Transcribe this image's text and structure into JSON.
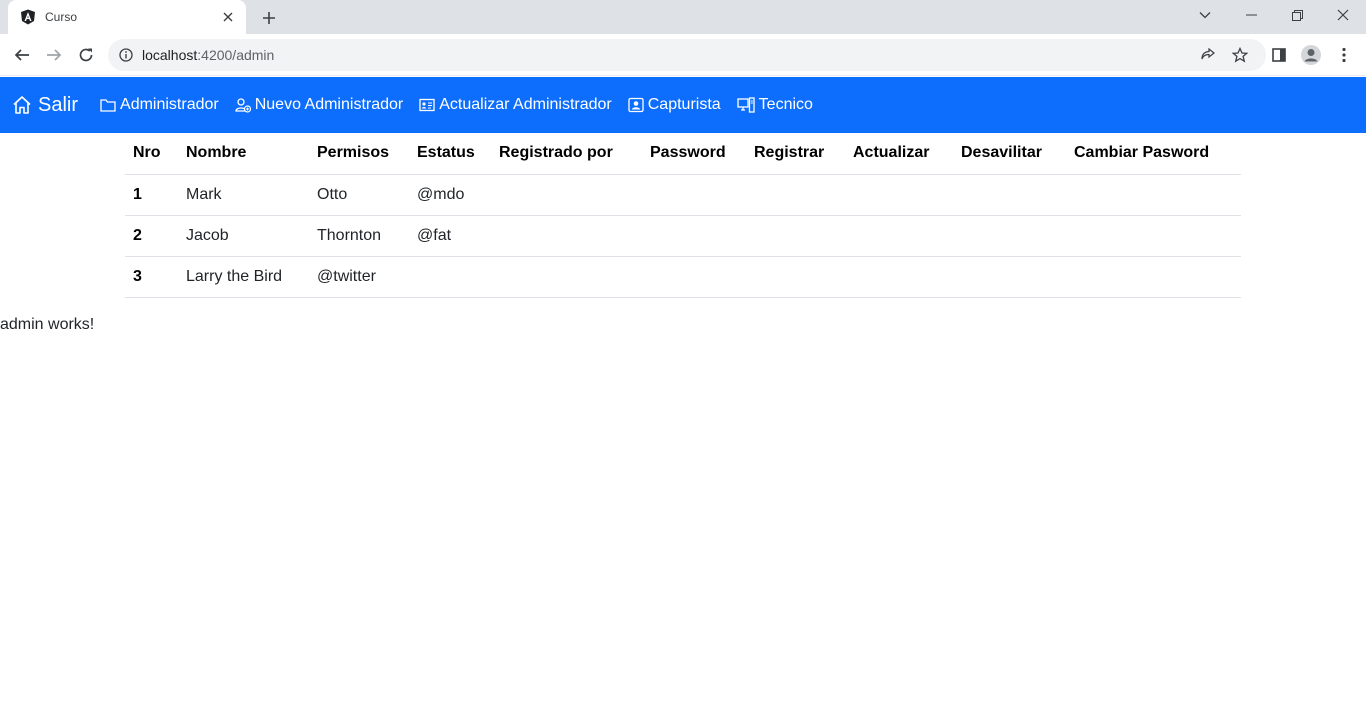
{
  "browser": {
    "tab_title": "Curso",
    "url_host": "localhost",
    "url_path": ":4200/admin"
  },
  "navbar": {
    "brand": "Salir",
    "links": [
      {
        "label": "Administrador",
        "icon": "folder-icon"
      },
      {
        "label": "Nuevo Administrador",
        "icon": "person-add-icon"
      },
      {
        "label": "Actualizar Administrador",
        "icon": "id-card-icon"
      },
      {
        "label": "Capturista",
        "icon": "person-badge-icon"
      },
      {
        "label": "Tecnico",
        "icon": "pc-display-icon"
      }
    ],
    "color": "#0d6efd"
  },
  "table": {
    "headers": [
      "Nro",
      "Nombre",
      "Permisos",
      "Estatus",
      "Registrado por",
      "Password",
      "Registrar",
      "Actualizar",
      "Desavilitar",
      "Cambiar Pasword"
    ],
    "rows": [
      [
        "1",
        "Mark",
        "Otto",
        "@mdo",
        "",
        "",
        "",
        "",
        "",
        ""
      ],
      [
        "2",
        "Jacob",
        "Thornton",
        "@fat",
        "",
        "",
        "",
        "",
        "",
        ""
      ],
      [
        "3",
        "Larry the Bird",
        "@twitter",
        "",
        "",
        "",
        "",
        "",
        "",
        ""
      ]
    ]
  },
  "footer_text": "admin works!"
}
